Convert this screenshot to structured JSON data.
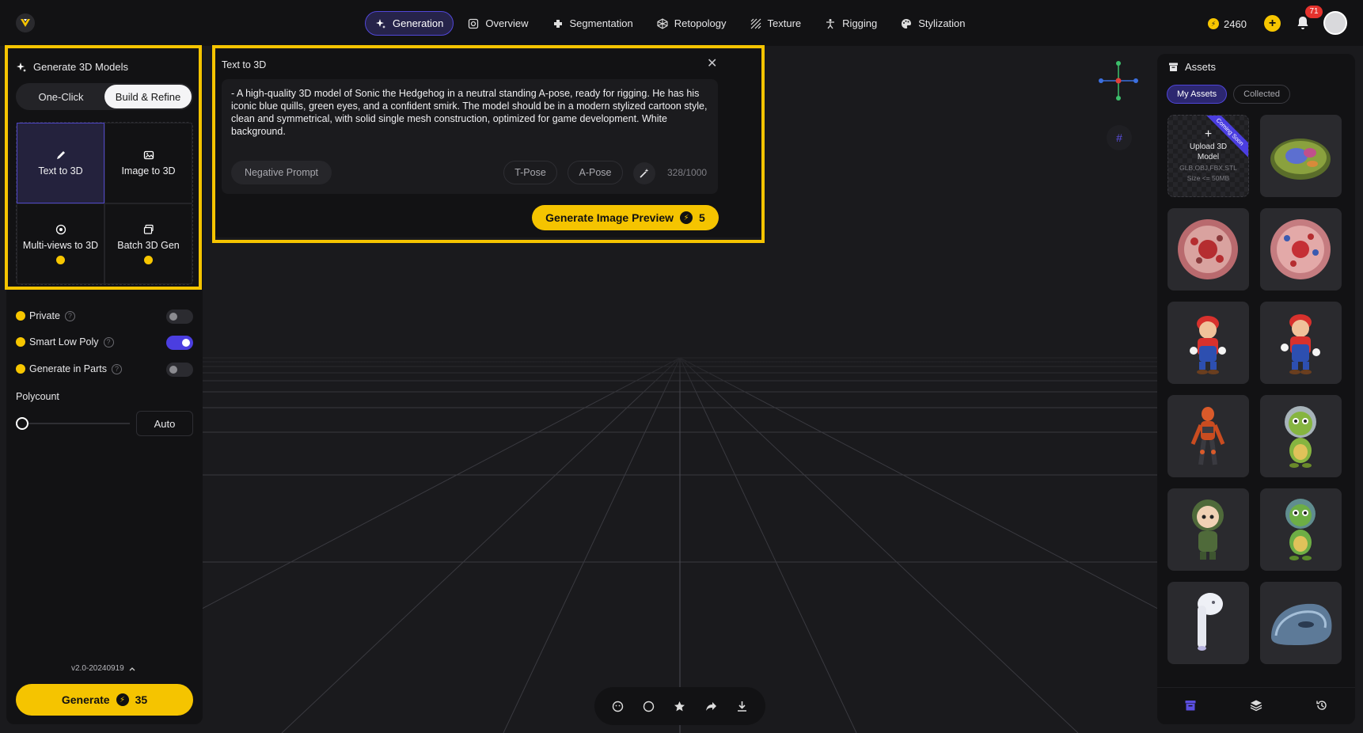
{
  "topbar": {
    "logo_icon": "meshy-logo-icon",
    "nav": [
      {
        "label": "Generation",
        "icon": "sparkle-icon",
        "active": true
      },
      {
        "label": "Overview",
        "icon": "scan-icon",
        "active": false
      },
      {
        "label": "Segmentation",
        "icon": "puzzle-icon",
        "active": false
      },
      {
        "label": "Retopology",
        "icon": "mesh-icon",
        "active": false
      },
      {
        "label": "Texture",
        "icon": "texture-icon",
        "active": false
      },
      {
        "label": "Rigging",
        "icon": "figure-icon",
        "active": false
      },
      {
        "label": "Stylization",
        "icon": "palette-icon",
        "active": false
      }
    ],
    "credits": "2460",
    "add_credits": "+",
    "notifications": "71"
  },
  "left_panel": {
    "title": "Generate 3D Models",
    "modes": [
      "One-Click",
      "Build & Refine"
    ],
    "active_mode": "Build & Refine",
    "tools": [
      {
        "label": "Text to 3D",
        "icon": "pencil-icon",
        "active": true,
        "premium": false
      },
      {
        "label": "Image to 3D",
        "icon": "image-icon",
        "active": false,
        "premium": false
      },
      {
        "label": "Multi-views to 3D",
        "icon": "multiview-icon",
        "active": false,
        "premium": true
      },
      {
        "label": "Batch 3D Gen",
        "icon": "batch-icon",
        "active": false,
        "premium": true
      }
    ],
    "options": [
      {
        "label": "Private",
        "on": false
      },
      {
        "label": "Smart Low Poly",
        "on": true
      },
      {
        "label": "Generate in Parts",
        "on": false
      }
    ],
    "polycount_label": "Polycount",
    "polycount_value": "Auto",
    "polycount_level": 0,
    "version": "v2.0-20240919",
    "generate_label": "Generate",
    "generate_cost": "35"
  },
  "text_to_3d": {
    "title": "Text to 3D",
    "prompt": "- A high-quality 3D model of Sonic the Hedgehog in a neutral standing A-pose, ready for rigging. He has his iconic blue quills, green eyes, and a confident smirk. The model should be in a modern stylized cartoon style, clean and symmetrical, with solid single mesh construction, optimized for game development. White background.",
    "negative_prompt": "Negative Prompt",
    "tpose": "T-Pose",
    "apose": "A-Pose",
    "char_count": "328/1000",
    "preview_label": "Generate Image Preview",
    "preview_cost": "5"
  },
  "assets": {
    "title": "Assets",
    "tabs": [
      "My Assets",
      "Collected"
    ],
    "active_tab": "My Assets",
    "upload": {
      "label": "Upload 3D Model",
      "formats": "GLB,OBJ,FBX,STL",
      "size": "Size <= 50MB",
      "ribbon": "Coming Soon"
    },
    "items": [
      "cell-model",
      "cell-top",
      "cell-side",
      "mario-a",
      "mario-b",
      "orange-robot",
      "green-alien-astronaut",
      "soldier-child",
      "green-alien-b",
      "white-earbud",
      "blue-device"
    ]
  },
  "colors": {
    "accent": "#f5c400",
    "brand": "#4b3ee0",
    "background": "#1a1a1d",
    "panel": "#121214"
  }
}
